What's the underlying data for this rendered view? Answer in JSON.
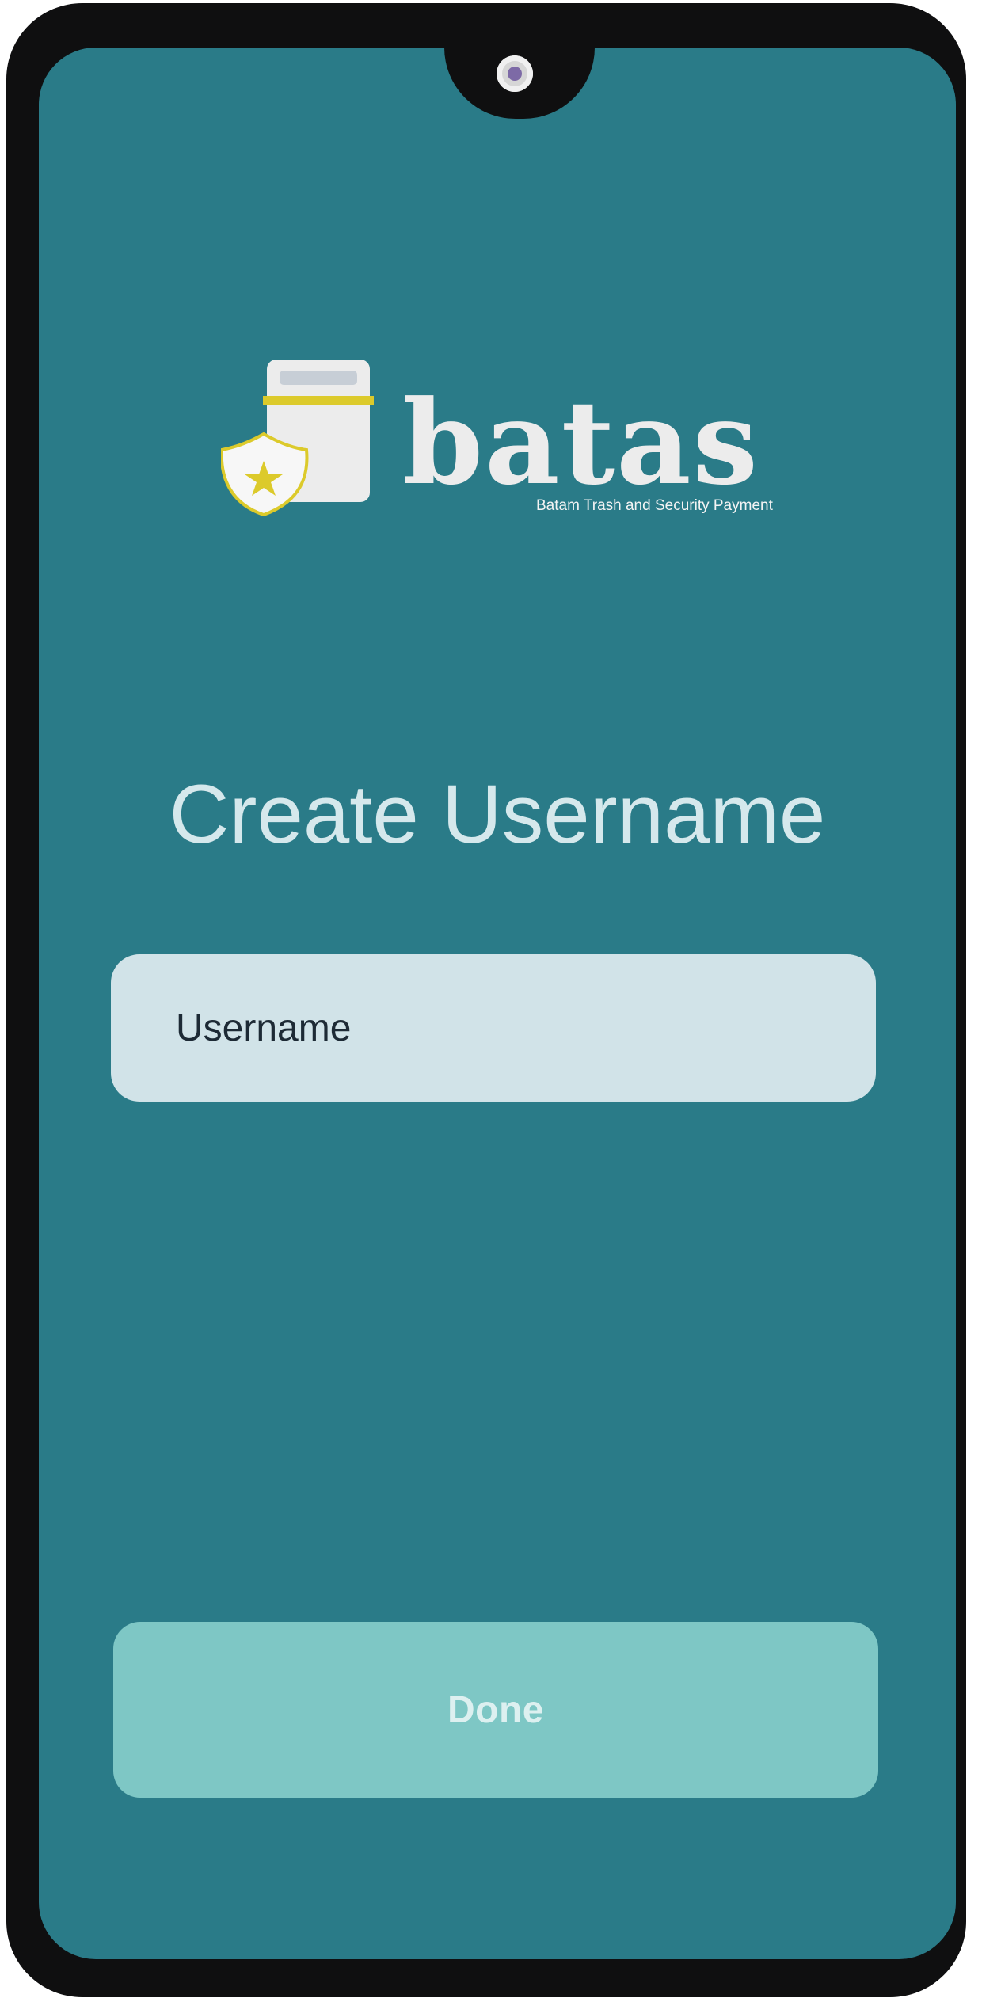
{
  "brand": {
    "wordmark": "batas",
    "tagline": "Batam Trash and Security Payment"
  },
  "screen": {
    "title": "Create Username"
  },
  "form": {
    "username_placeholder": "Username",
    "username_value": ""
  },
  "actions": {
    "done_label": "Done"
  },
  "colors": {
    "screen_background": "#2a7b88",
    "input_background": "#d1e3e8",
    "button_background": "#7ec7c5",
    "title_text": "#d5e8ec",
    "logo_light": "#ececec",
    "logo_accent": "#dcca2b",
    "phone_frame": "#0f0f10"
  },
  "icons": {
    "logo_symbol": "trash-bin-with-security-badge",
    "camera": "front-camera"
  }
}
